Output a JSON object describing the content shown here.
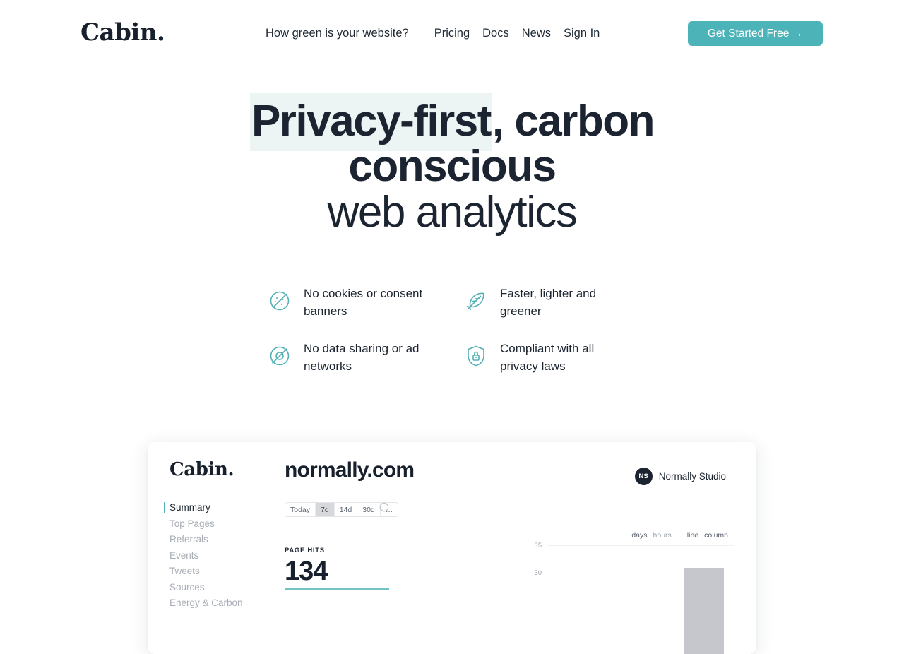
{
  "nav": {
    "logo": "Cabin.",
    "links": [
      {
        "label": "How green is your website?",
        "name": "nav-link-how-green"
      },
      {
        "label": "Pricing",
        "name": "nav-link-pricing"
      },
      {
        "label": "Docs",
        "name": "nav-link-docs"
      },
      {
        "label": "News",
        "name": "nav-link-news"
      },
      {
        "label": "Sign In",
        "name": "nav-link-sign-in"
      }
    ],
    "cta_label": "Get Started Free →"
  },
  "hero": {
    "line1_highlight": "Privacy-first",
    "line1_rest": ", carbon",
    "line2": "conscious",
    "line3": "web analytics"
  },
  "features": [
    {
      "icon": "no-cookies-icon",
      "text": "No cookies or consent banners"
    },
    {
      "icon": "feather-icon",
      "text": "Faster, lighter and greener"
    },
    {
      "icon": "no-tracking-icon",
      "text": "No data sharing or ad networks"
    },
    {
      "icon": "shield-lock-icon",
      "text": "Compliant with all privacy laws"
    }
  ],
  "dashboard": {
    "logo": "Cabin.",
    "menu": [
      {
        "label": "Summary",
        "active": true
      },
      {
        "label": "Top Pages",
        "active": false
      },
      {
        "label": "Referrals",
        "active": false
      },
      {
        "label": "Events",
        "active": false
      },
      {
        "label": "Tweets",
        "active": false
      },
      {
        "label": "Sources",
        "active": false
      },
      {
        "label": "Energy & Carbon",
        "active": false
      }
    ],
    "site_title": "normally.com",
    "account": {
      "initials": "NS",
      "name": "Normally Studio"
    },
    "ranges": [
      {
        "label": "Today",
        "active": false
      },
      {
        "label": "7d",
        "active": true
      },
      {
        "label": "14d",
        "active": false
      },
      {
        "label": "30d",
        "active": false
      },
      {
        "label": "…",
        "active": false
      }
    ],
    "stat": {
      "label": "PAGE HITS",
      "value": "134"
    },
    "toggles": {
      "interval": [
        {
          "label": "days",
          "state": "teal"
        },
        {
          "label": "hours",
          "state": "off"
        }
      ],
      "style": [
        {
          "label": "line",
          "state": "dark"
        },
        {
          "label": "column",
          "state": "teal"
        }
      ]
    }
  },
  "chart_data": {
    "type": "bar",
    "title": "",
    "xlabel": "",
    "ylabel": "",
    "categories": [
      "",
      "",
      "",
      "",
      "",
      "",
      ""
    ],
    "values": [
      null,
      null,
      null,
      null,
      null,
      null,
      31
    ],
    "ytick_labels": [
      "35",
      "30"
    ],
    "ytick_values": [
      35,
      30
    ],
    "ylim": [
      25,
      36
    ],
    "grid": true,
    "legend": "none",
    "bar_color": "#c6c7cc",
    "note": "Only the top of the chart is visible; a single gray column near 31 is rendered at the right edge."
  },
  "colors": {
    "accent": "#4cb4b9",
    "highlight": "#ecf5f4",
    "text": "#1b2430",
    "muted": "#a7adb4",
    "bar": "#c6c7cc"
  }
}
